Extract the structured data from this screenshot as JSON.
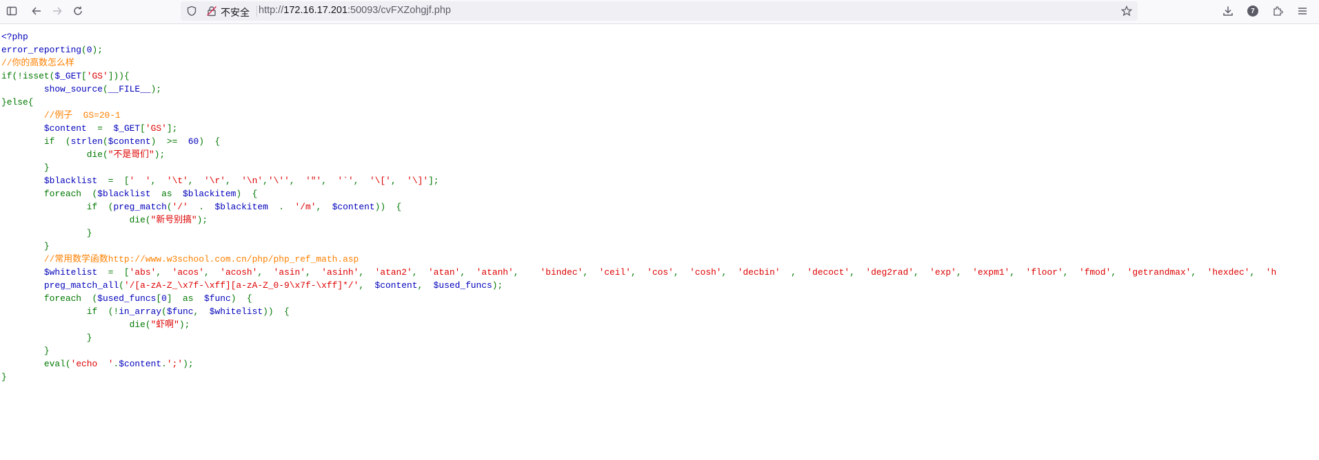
{
  "browser": {
    "insecure_label": "不安全",
    "url_prefix": "http://",
    "url_host": "172.16.17.201",
    "url_path": ":50093/cvFXZohgjf.php",
    "extensions_badge": "7"
  },
  "source_lines": [
    [
      [
        "html",
        "<?php"
      ]
    ],
    [
      [
        "df",
        "error_reporting"
      ],
      [
        "kw",
        "("
      ],
      [
        "df",
        "0"
      ],
      [
        "kw",
        ");"
      ]
    ],
    [
      [
        "cm",
        "//你的高数怎么样"
      ]
    ],
    [
      [
        "kw",
        "if(!isset("
      ],
      [
        "df",
        "$_GET"
      ],
      [
        "kw",
        "["
      ],
      [
        "str",
        "'GS'"
      ],
      [
        "kw",
        "])){"
      ]
    ],
    [
      [
        "kw",
        "        "
      ],
      [
        "df",
        "show_source"
      ],
      [
        "kw",
        "("
      ],
      [
        "df",
        "__FILE__"
      ],
      [
        "kw",
        ");"
      ]
    ],
    [
      [
        "kw",
        "}else{"
      ]
    ],
    [
      [
        "kw",
        "        "
      ],
      [
        "cm",
        "//例子  GS=20-1"
      ]
    ],
    [
      [
        "kw",
        "        "
      ],
      [
        "df",
        "$content  "
      ],
      [
        "kw",
        "=  "
      ],
      [
        "df",
        "$_GET"
      ],
      [
        "kw",
        "["
      ],
      [
        "str",
        "'GS'"
      ],
      [
        "kw",
        "];"
      ]
    ],
    [
      [
        "kw",
        "        if  ("
      ],
      [
        "df",
        "strlen"
      ],
      [
        "kw",
        "("
      ],
      [
        "df",
        "$content"
      ],
      [
        "kw",
        ")  >=  "
      ],
      [
        "df",
        "60"
      ],
      [
        "kw",
        ")  {"
      ]
    ],
    [
      [
        "kw",
        "                die("
      ],
      [
        "str",
        "\"不是哥们\""
      ],
      [
        "kw",
        ");"
      ]
    ],
    [
      [
        "kw",
        "        }"
      ]
    ],
    [
      [
        "kw",
        "        "
      ],
      [
        "df",
        "$blacklist  "
      ],
      [
        "kw",
        "=  ["
      ],
      [
        "str",
        "'  '"
      ],
      [
        "kw",
        ",  "
      ],
      [
        "str",
        "'\\t'"
      ],
      [
        "kw",
        ",  "
      ],
      [
        "str",
        "'\\r'"
      ],
      [
        "kw",
        ",  "
      ],
      [
        "str",
        "'\\n'"
      ],
      [
        "kw",
        ","
      ],
      [
        "str",
        "'\\''"
      ],
      [
        "kw",
        ",  "
      ],
      [
        "str",
        "'\"'"
      ],
      [
        "kw",
        ",  "
      ],
      [
        "str",
        "'`'"
      ],
      [
        "kw",
        ",  "
      ],
      [
        "str",
        "'\\['"
      ],
      [
        "kw",
        ",  "
      ],
      [
        "str",
        "'\\]'"
      ],
      [
        "kw",
        "];"
      ]
    ],
    [
      [
        "kw",
        "        foreach  ("
      ],
      [
        "df",
        "$blacklist  "
      ],
      [
        "kw",
        "as  "
      ],
      [
        "df",
        "$blackitem"
      ],
      [
        "kw",
        ")  {"
      ]
    ],
    [
      [
        "kw",
        "                if  ("
      ],
      [
        "df",
        "preg_match"
      ],
      [
        "kw",
        "("
      ],
      [
        "str",
        "'/'  "
      ],
      [
        "kw",
        ".  "
      ],
      [
        "df",
        "$blackitem  "
      ],
      [
        "kw",
        ".  "
      ],
      [
        "str",
        "'/m'"
      ],
      [
        "kw",
        ",  "
      ],
      [
        "df",
        "$content"
      ],
      [
        "kw",
        "))  {"
      ]
    ],
    [
      [
        "kw",
        "                        die("
      ],
      [
        "str",
        "\"新号别搞\""
      ],
      [
        "kw",
        ");"
      ]
    ],
    [
      [
        "kw",
        "                }"
      ]
    ],
    [
      [
        "kw",
        "        }"
      ]
    ],
    [
      [
        "kw",
        "        "
      ],
      [
        "cm",
        "//常用数学函数http://www.w3school.com.cn/php/php_ref_math.asp"
      ]
    ],
    [
      [
        "kw",
        "        "
      ],
      [
        "df",
        "$whitelist  "
      ],
      [
        "kw",
        "=  ["
      ],
      [
        "str",
        "'abs'"
      ],
      [
        "kw",
        ",  "
      ],
      [
        "str",
        "'acos'"
      ],
      [
        "kw",
        ",  "
      ],
      [
        "str",
        "'acosh'"
      ],
      [
        "kw",
        ",  "
      ],
      [
        "str",
        "'asin'"
      ],
      [
        "kw",
        ",  "
      ],
      [
        "str",
        "'asinh'"
      ],
      [
        "kw",
        ",  "
      ],
      [
        "str",
        "'atan2'"
      ],
      [
        "kw",
        ",  "
      ],
      [
        "str",
        "'atan'"
      ],
      [
        "kw",
        ",  "
      ],
      [
        "str",
        "'atanh'"
      ],
      [
        "kw",
        ",    "
      ],
      [
        "str",
        "'bindec'"
      ],
      [
        "kw",
        ",  "
      ],
      [
        "str",
        "'ceil'"
      ],
      [
        "kw",
        ",  "
      ],
      [
        "str",
        "'cos'"
      ],
      [
        "kw",
        ",  "
      ],
      [
        "str",
        "'cosh'"
      ],
      [
        "kw",
        ",  "
      ],
      [
        "str",
        "'decbin'  "
      ],
      [
        "kw",
        ",  "
      ],
      [
        "str",
        "'decoct'"
      ],
      [
        "kw",
        ",  "
      ],
      [
        "str",
        "'deg2rad'"
      ],
      [
        "kw",
        ",  "
      ],
      [
        "str",
        "'exp'"
      ],
      [
        "kw",
        ",  "
      ],
      [
        "str",
        "'expm1'"
      ],
      [
        "kw",
        ",  "
      ],
      [
        "str",
        "'floor'"
      ],
      [
        "kw",
        ",  "
      ],
      [
        "str",
        "'fmod'"
      ],
      [
        "kw",
        ",  "
      ],
      [
        "str",
        "'getrandmax'"
      ],
      [
        "kw",
        ",  "
      ],
      [
        "str",
        "'hexdec'"
      ],
      [
        "kw",
        ",  "
      ],
      [
        "str",
        "'h"
      ]
    ],
    [
      [
        "kw",
        "        "
      ],
      [
        "df",
        "preg_match_all"
      ],
      [
        "kw",
        "("
      ],
      [
        "str",
        "'/[a-zA-Z_\\x7f-\\xff][a-zA-Z_0-9\\x7f-\\xff]*/'"
      ],
      [
        "kw",
        ",  "
      ],
      [
        "df",
        "$content"
      ],
      [
        "kw",
        ",  "
      ],
      [
        "df",
        "$used_funcs"
      ],
      [
        "kw",
        ");"
      ]
    ],
    [
      [
        "kw",
        "        foreach  ("
      ],
      [
        "df",
        "$used_funcs"
      ],
      [
        "kw",
        "["
      ],
      [
        "df",
        "0"
      ],
      [
        "kw",
        "]  as  "
      ],
      [
        "df",
        "$func"
      ],
      [
        "kw",
        ")  {"
      ]
    ],
    [
      [
        "kw",
        "                if  (!"
      ],
      [
        "df",
        "in_array"
      ],
      [
        "kw",
        "("
      ],
      [
        "df",
        "$func"
      ],
      [
        "kw",
        ",  "
      ],
      [
        "df",
        "$whitelist"
      ],
      [
        "kw",
        "))  {"
      ]
    ],
    [
      [
        "kw",
        "                        die("
      ],
      [
        "str",
        "\"虾啊\""
      ],
      [
        "kw",
        ");"
      ]
    ],
    [
      [
        "kw",
        "                }"
      ]
    ],
    [
      [
        "kw",
        "        }"
      ]
    ],
    [
      [
        "kw",
        "        eval("
      ],
      [
        "str",
        "'echo  '"
      ],
      [
        "kw",
        "."
      ],
      [
        "df",
        "$content"
      ],
      [
        "kw",
        "."
      ],
      [
        "str",
        "';'"
      ],
      [
        "kw",
        ");"
      ]
    ],
    [
      [
        "kw",
        "}"
      ]
    ]
  ]
}
